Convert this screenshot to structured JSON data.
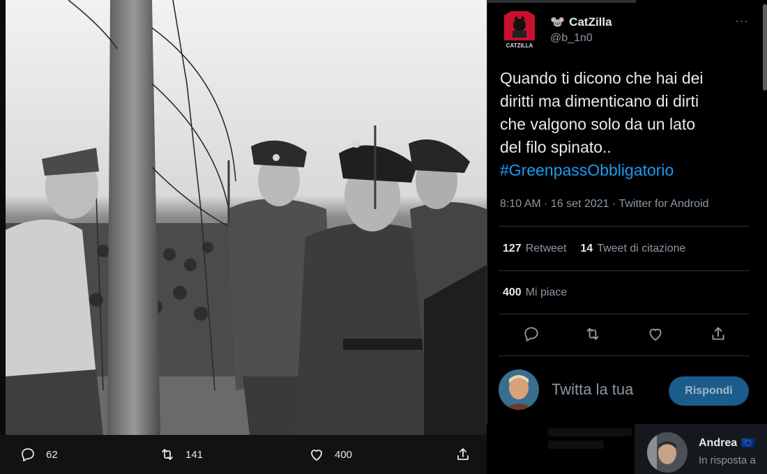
{
  "photo": {
    "alt_subject": "black-and-white photograph"
  },
  "media_actions": {
    "reply_count": "62",
    "retweet_count": "141",
    "like_count": "400"
  },
  "tweet": {
    "author": {
      "display_name": "CatZilla",
      "name_emoji": "🐭",
      "handle": "@b_1n0",
      "avatar_text": "CATZILLA"
    },
    "more_label": "···",
    "text_lines": [
      "Quando ti dicono che hai dei",
      "diritti ma dimenticano di dirti",
      "che valgono solo da un lato",
      "del filo spinato.."
    ],
    "hashtag": "#GreenpassObbligatorio",
    "meta": "8:10 AM · 16 set 2021 · Twitter for Android",
    "stats": {
      "retweets_value": "127",
      "retweets_label": "Retweet",
      "quotes_value": "14",
      "quotes_label": "Tweet di citazione",
      "likes_value": "400",
      "likes_label": "Mi piace"
    }
  },
  "reply": {
    "placeholder": "Twitta la tua",
    "button_label": "Rispondi"
  },
  "next_tweet": {
    "display_name": "Andrea",
    "flag": "🇪🇺",
    "subtitle": "In risposta a"
  },
  "colors": {
    "background": "#000000",
    "accent": "#1d9bf0",
    "reply_button": "#1a5c8c",
    "secondary_text": "#8b98a5"
  }
}
